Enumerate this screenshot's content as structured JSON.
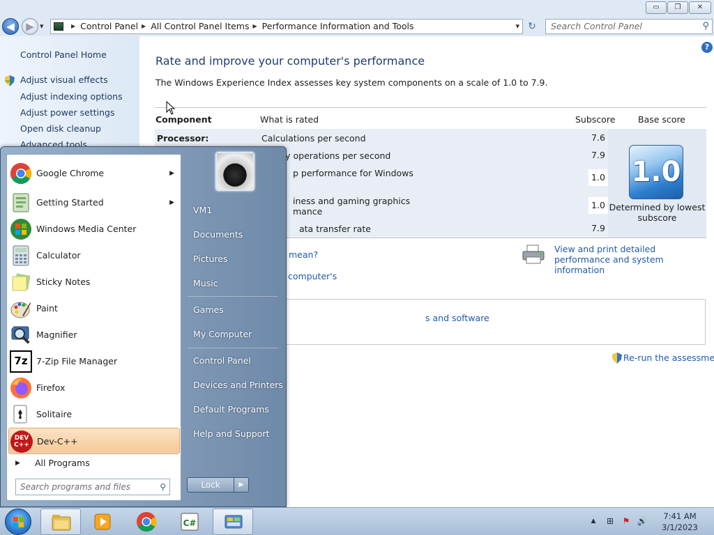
{
  "window": {
    "minimize_glyph": "▭",
    "maximize_glyph": "❐",
    "close_glyph": "✕"
  },
  "nav": {
    "back_glyph": "◀",
    "forward_glyph": "▶",
    "dropdown_glyph": "▾",
    "breadcrumbs": [
      "Control Panel",
      "All Control Panel Items",
      "Performance Information and Tools"
    ],
    "refresh_glyph": "↻",
    "search_placeholder": "Search Control Panel",
    "search_glyph": "⚲"
  },
  "sidebar": {
    "home": "Control Panel Home",
    "links": [
      "Adjust visual effects",
      "Adjust indexing options",
      "Adjust power settings",
      "Open disk cleanup",
      "Advanced tools"
    ]
  },
  "main": {
    "help_glyph": "?",
    "title": "Rate and improve your computer's performance",
    "description": "The Windows Experience Index assesses key system components on a scale of 1.0 to 7.9.",
    "table": {
      "headers": {
        "component": "Component",
        "what": "What is rated",
        "subscore": "Subscore",
        "base": "Base score"
      },
      "rows": [
        {
          "component": "Processor:",
          "what": "Calculations per second",
          "subscore": "7.6"
        },
        {
          "component": "",
          "what": "ry operations per second",
          "subscore": "7.9"
        },
        {
          "component": "",
          "what": "p performance for Windows",
          "subscore": "1.0"
        },
        {
          "component": "",
          "what": "iness and gaming graphics",
          "what2": "mance",
          "subscore": "1.0"
        },
        {
          "component": "",
          "what": "ata transfer rate",
          "subscore": "7.9"
        }
      ],
      "base_score": "1.0",
      "determined_by": "Determined by lowest subscore"
    },
    "links": {
      "mean": "mean?",
      "computers": "computer's",
      "view_print": "View and print detailed performance and system information",
      "software": "s and software",
      "rerun": "Re-run the assessment"
    }
  },
  "start_menu": {
    "programs": [
      {
        "label": "Google Chrome",
        "arrow": "▶"
      },
      {
        "label": "Getting Started",
        "arrow": "▶"
      },
      {
        "label": "Windows Media Center",
        "arrow": ""
      },
      {
        "label": "Calculator",
        "arrow": ""
      },
      {
        "label": "Sticky Notes",
        "arrow": ""
      },
      {
        "label": "Paint",
        "arrow": ""
      },
      {
        "label": "Magnifier",
        "arrow": ""
      },
      {
        "label": "7-Zip File Manager",
        "arrow": ""
      },
      {
        "label": "Firefox",
        "arrow": ""
      },
      {
        "label": "Solitaire",
        "arrow": ""
      },
      {
        "label": "Dev-C++",
        "arrow": ""
      }
    ],
    "all_programs": "All Programs",
    "all_programs_glyph": "▶",
    "search_placeholder": "Search programs and files",
    "search_glyph": "⚲",
    "right_items": [
      "VM1",
      "Documents",
      "Pictures",
      "Music",
      "Games",
      "My Computer",
      "Control Panel",
      "Devices and Printers",
      "Default Programs",
      "Help and Support"
    ],
    "lock": "Lock",
    "lock_arrow": "▶",
    "dev_icon_text": "DEV\nC++",
    "zip_icon_text": "7z"
  },
  "taskbar": {
    "pinned": [
      "windows-explorer",
      "windows-media-player",
      "google-chrome",
      "visual-studio",
      "control-panel"
    ],
    "clock_time": "7:41 AM",
    "clock_date": "3/1/2023",
    "tray_glyphs": {
      "show_hidden": "▲",
      "network": "⊞",
      "action_center": "⚑",
      "volume": "🔊"
    }
  },
  "colors": {
    "link": "#1f5aa6",
    "title": "#1e3b6e",
    "highlight": "#f7c896"
  }
}
